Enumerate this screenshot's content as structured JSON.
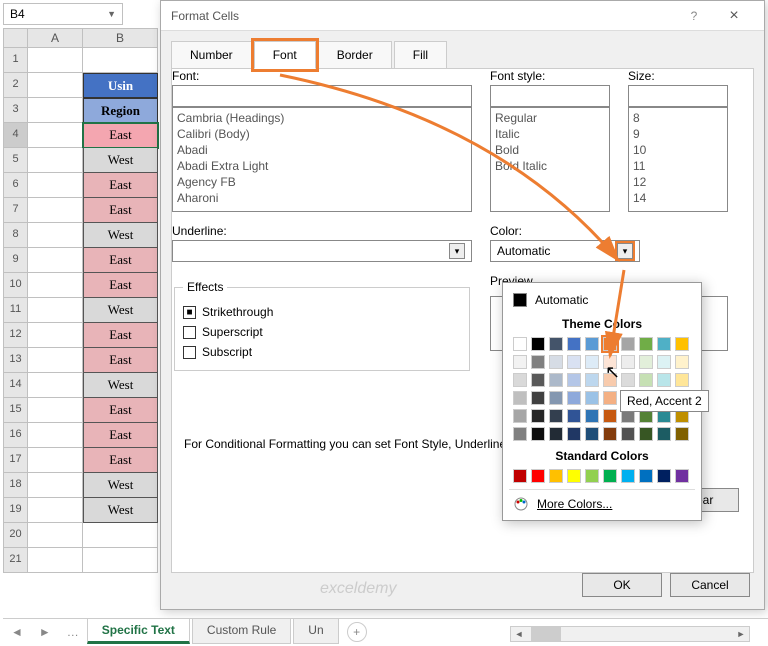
{
  "namebox": {
    "value": "B4"
  },
  "columns": [
    "A",
    "B"
  ],
  "rows": [
    "1",
    "2",
    "3",
    "4",
    "5",
    "6",
    "7",
    "8",
    "9",
    "10",
    "11",
    "12",
    "13",
    "14",
    "15",
    "16",
    "17",
    "18",
    "19",
    "20",
    "21"
  ],
  "table": {
    "title": "Usin",
    "header": "Region",
    "data": [
      {
        "v": "East",
        "cls": "east sel"
      },
      {
        "v": "West",
        "cls": "west"
      },
      {
        "v": "East",
        "cls": "east"
      },
      {
        "v": "East",
        "cls": "east"
      },
      {
        "v": "West",
        "cls": "west"
      },
      {
        "v": "East",
        "cls": "east"
      },
      {
        "v": "East",
        "cls": "east"
      },
      {
        "v": "West",
        "cls": "west"
      },
      {
        "v": "East",
        "cls": "east"
      },
      {
        "v": "East",
        "cls": "east"
      },
      {
        "v": "West",
        "cls": "west"
      },
      {
        "v": "East",
        "cls": "east"
      },
      {
        "v": "East",
        "cls": "east"
      },
      {
        "v": "East",
        "cls": "east"
      },
      {
        "v": "West",
        "cls": "west"
      },
      {
        "v": "West",
        "cls": "west"
      }
    ]
  },
  "dialog": {
    "title": "Format Cells",
    "tabs": [
      "Number",
      "Font",
      "Border",
      "Fill"
    ],
    "active_tab": "Font",
    "font_label": "Font:",
    "font_list": [
      "Cambria (Headings)",
      "Calibri (Body)",
      "Abadi",
      "Abadi Extra Light",
      "Agency FB",
      "Aharoni"
    ],
    "font_style_label": "Font style:",
    "font_style_list": [
      "Regular",
      "Italic",
      "Bold",
      "Bold Italic"
    ],
    "size_label": "Size:",
    "size_list": [
      "8",
      "9",
      "10",
      "11",
      "12",
      "14"
    ],
    "underline_label": "Underline:",
    "color_label": "Color:",
    "color_value": "Automatic",
    "effects_label": "Effects",
    "effects": [
      {
        "label": "Strikethrough",
        "checked": true
      },
      {
        "label": "Superscript",
        "checked": false
      },
      {
        "label": "Subscript",
        "checked": false
      }
    ],
    "preview_label": "Preview",
    "note": "For Conditional Formatting you can set Font Style, Underline, Color, and Strikethrough.",
    "clear": "Clear",
    "ok": "OK",
    "cancel": "Cancel"
  },
  "colorpicker": {
    "automatic": "Automatic",
    "theme_label": "Theme Colors",
    "theme_row1": [
      "#ffffff",
      "#000000",
      "#44546a",
      "#4472c4",
      "#5b9bd5",
      "#ed7d31",
      "#a5a5a5",
      "#70ad47",
      "#4fb0c6",
      "#ffc000"
    ],
    "tint_rows": [
      [
        "#f2f2f2",
        "#808080",
        "#d6dce5",
        "#d9e1f2",
        "#ddebf7",
        "#fce4d6",
        "#ededed",
        "#e2efda",
        "#dcf2f4",
        "#fff2cc"
      ],
      [
        "#d9d9d9",
        "#595959",
        "#acb9ca",
        "#b4c6e7",
        "#bdd7ee",
        "#f8cbad",
        "#dbdbdb",
        "#c6e0b4",
        "#b9e5e9",
        "#ffe699"
      ],
      [
        "#bfbfbf",
        "#404040",
        "#8497b0",
        "#8ea9db",
        "#9bc2e6",
        "#f4b084",
        "#c9c9c9",
        "#a9d08e",
        "#96d8de",
        "#ffd966"
      ],
      [
        "#a6a6a6",
        "#262626",
        "#333f4f",
        "#305496",
        "#2f75b5",
        "#c65911",
        "#7b7b7b",
        "#548235",
        "#2a8a94",
        "#bf8f00"
      ],
      [
        "#808080",
        "#0d0d0d",
        "#222b35",
        "#203764",
        "#1f4e78",
        "#833c0c",
        "#525252",
        "#375623",
        "#1c5c63",
        "#806000"
      ]
    ],
    "standard_label": "Standard Colors",
    "standard": [
      "#c00000",
      "#ff0000",
      "#ffc000",
      "#ffff00",
      "#92d050",
      "#00b050",
      "#00b0f0",
      "#0070c0",
      "#002060",
      "#7030a0"
    ],
    "more": "More Colors...",
    "tooltip": "Red, Accent 2"
  },
  "sheettabs": {
    "nav": "…",
    "tabs": [
      "Specific Text",
      "Custom Rule",
      "Un"
    ],
    "active": "Specific Text"
  },
  "watermark": "exceldemy"
}
